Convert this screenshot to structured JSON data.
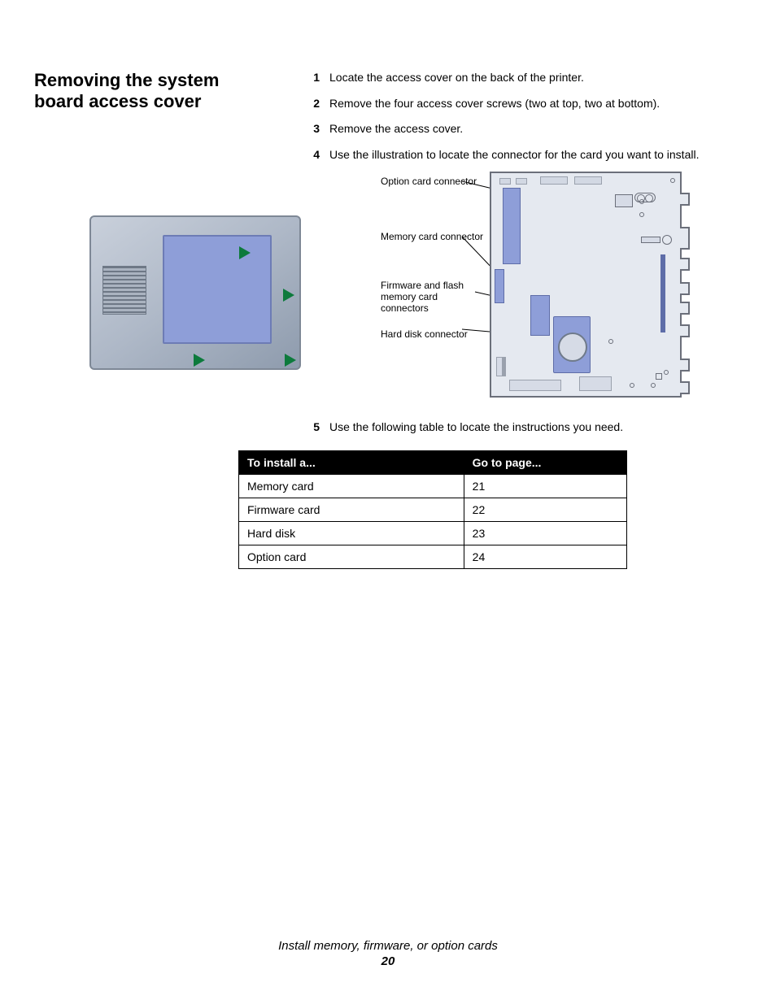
{
  "section_title": "Removing the system board access cover",
  "steps": [
    {
      "n": "1",
      "text": "Locate the access cover on the back of the printer."
    },
    {
      "n": "2",
      "text": "Remove the four access cover screws (two at top, two at bottom)."
    },
    {
      "n": "3",
      "text": "Remove the access cover."
    },
    {
      "n": "4",
      "text": "Use the illustration to locate the connector for the card you want to install."
    }
  ],
  "diagram_labels": {
    "option_card": "Option card connector",
    "memory_card": "Memory card connector",
    "firmware_flash": "Firmware and flash memory card connectors",
    "hard_disk": "Hard disk connector"
  },
  "step5": {
    "n": "5",
    "text": "Use the following table to locate the instructions you need."
  },
  "table": {
    "headers": [
      "To install a...",
      "Go to page..."
    ],
    "rows": [
      [
        "Memory card",
        "21"
      ],
      [
        "Firmware card",
        "22"
      ],
      [
        "Hard disk",
        "23"
      ],
      [
        "Option card",
        "24"
      ]
    ]
  },
  "footer": {
    "chapter": "Install memory, firmware, or option cards",
    "page_number": "20"
  }
}
